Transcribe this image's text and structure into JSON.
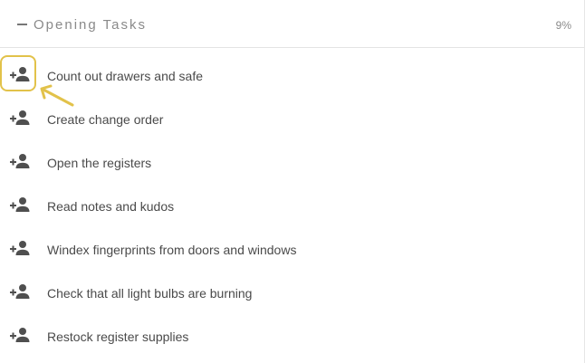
{
  "section": {
    "title": "Opening Tasks",
    "percent_complete": "9%",
    "collapse_icon": "minus-icon"
  },
  "tasks": [
    {
      "label": "Count out drawers and safe",
      "icon": "add-person-icon"
    },
    {
      "label": "Create change order",
      "icon": "add-person-icon"
    },
    {
      "label": "Open the registers",
      "icon": "add-person-icon"
    },
    {
      "label": "Read notes and kudos",
      "icon": "add-person-icon"
    },
    {
      "label": "Windex fingerprints from doors and windows",
      "icon": "add-person-icon"
    },
    {
      "label": "Check that all light bulbs are burning",
      "icon": "add-person-icon"
    },
    {
      "label": "Restock register supplies",
      "icon": "add-person-icon"
    }
  ],
  "annotation": {
    "highlight_color": "#e2c24a",
    "target": "first-task-assign-button"
  },
  "colors": {
    "icon": "#4f4f4f",
    "task_text": "#4a4a4a",
    "header_text": "#8a8a8a"
  }
}
